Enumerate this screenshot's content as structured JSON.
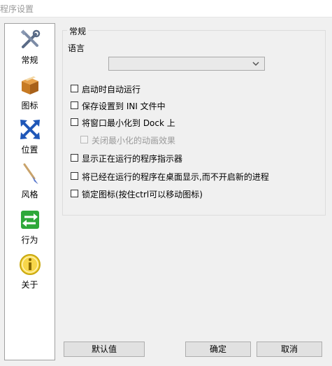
{
  "window": {
    "title": "程序设置"
  },
  "sidebar": {
    "items": [
      {
        "label": "常规",
        "icon": "tools-icon"
      },
      {
        "label": "图标",
        "icon": "box-icon"
      },
      {
        "label": "位置",
        "icon": "move-arrows-icon"
      },
      {
        "label": "风格",
        "icon": "brush-icon"
      },
      {
        "label": "行为",
        "icon": "swap-arrows-icon"
      },
      {
        "label": "关于",
        "icon": "info-icon"
      }
    ]
  },
  "general": {
    "group_title": "常规",
    "language_label": "语言",
    "language_value": "",
    "options": [
      {
        "label": "启动时自动运行",
        "checked": false,
        "disabled": false
      },
      {
        "label": "保存设置到 INI 文件中",
        "checked": false,
        "disabled": false
      },
      {
        "label": "将窗口最小化到 Dock 上",
        "checked": false,
        "disabled": false
      },
      {
        "label": "关闭最小化的动画效果",
        "checked": false,
        "disabled": true
      },
      {
        "label": "显示正在运行的程序指示器",
        "checked": false,
        "disabled": false
      },
      {
        "label": "将已经在运行的程序在桌面显示,而不开启新的进程",
        "checked": false,
        "disabled": false
      },
      {
        "label": "锁定图标(按住ctrl可以移动图标)",
        "checked": false,
        "disabled": false
      }
    ]
  },
  "footer": {
    "default_label": "默认值",
    "ok_label": "确定",
    "cancel_label": "取消"
  }
}
